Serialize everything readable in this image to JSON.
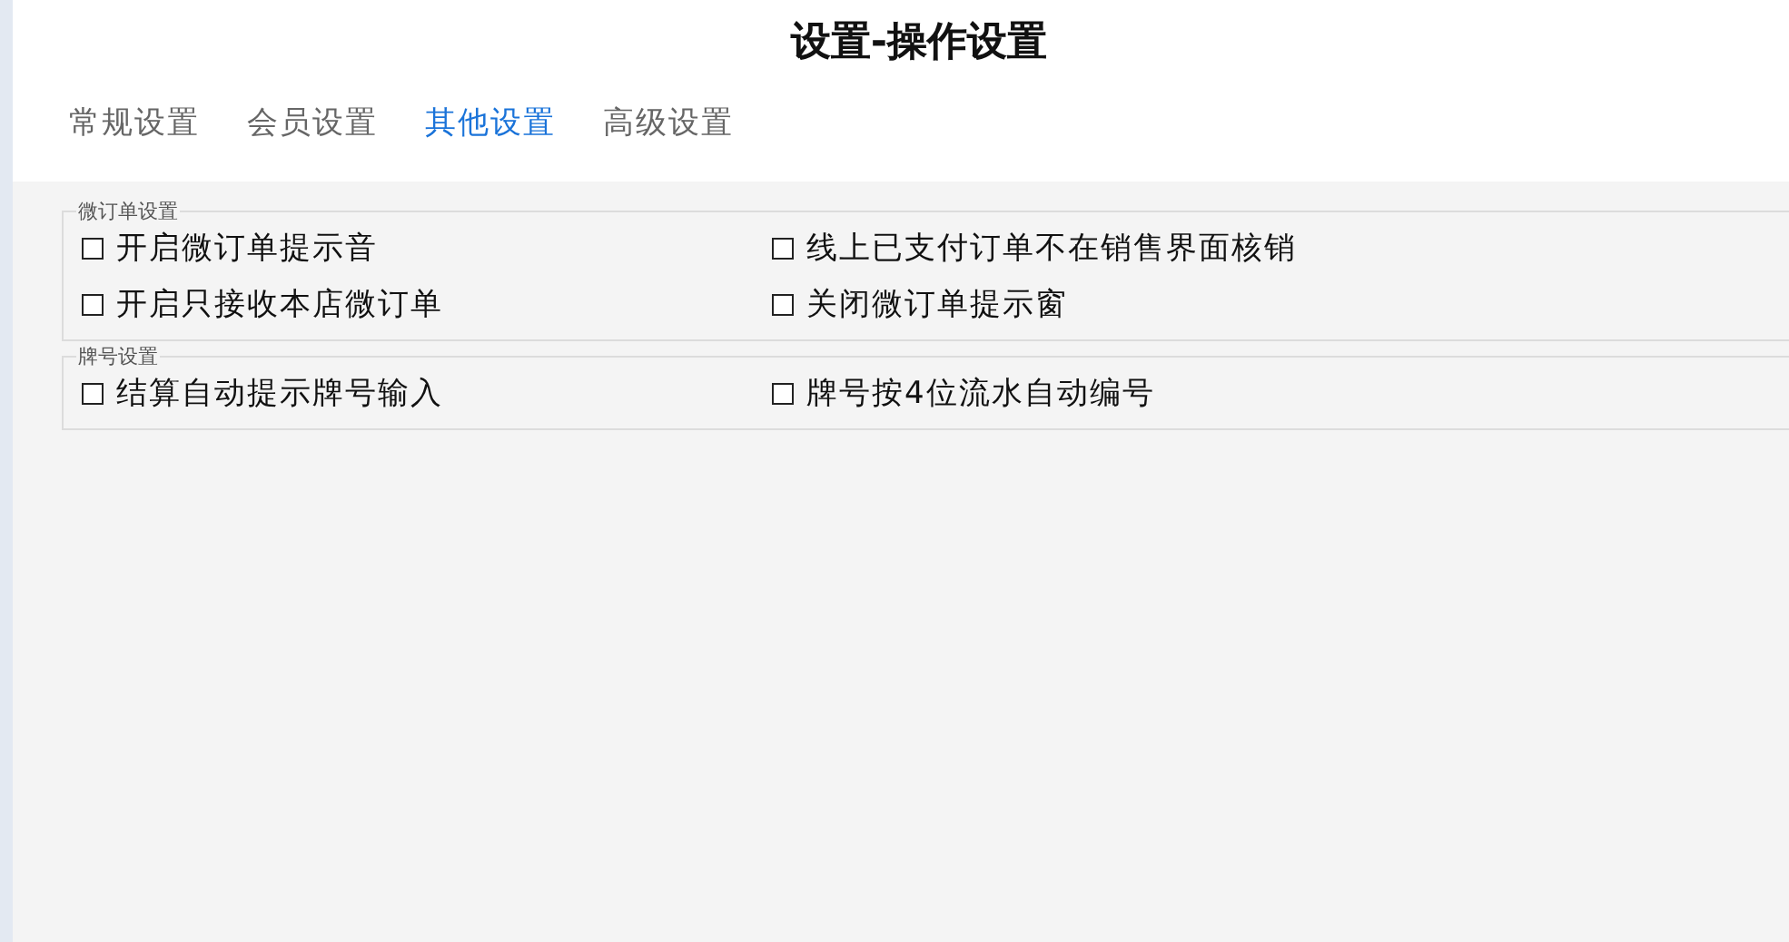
{
  "window": {
    "title": "设置-操作设置"
  },
  "tabs": [
    {
      "label": "常规设置",
      "selected": false
    },
    {
      "label": "会员设置",
      "selected": false
    },
    {
      "label": "其他设置",
      "selected": true
    },
    {
      "label": "高级设置",
      "selected": false
    }
  ],
  "groups": [
    {
      "legend": "微订单设置",
      "options": [
        {
          "label": "开启微订单提示音",
          "checked": false
        },
        {
          "label": "线上已支付订单不在销售界面核销",
          "checked": false
        },
        {
          "label": "开启只接收本店微订单",
          "checked": false
        },
        {
          "label": "关闭微订单提示窗",
          "checked": false
        }
      ]
    },
    {
      "legend": "牌号设置",
      "options": [
        {
          "label": "结算自动提示牌号输入",
          "checked": false
        },
        {
          "label": "牌号按4位流水自动编号",
          "checked": false
        }
      ]
    }
  ]
}
